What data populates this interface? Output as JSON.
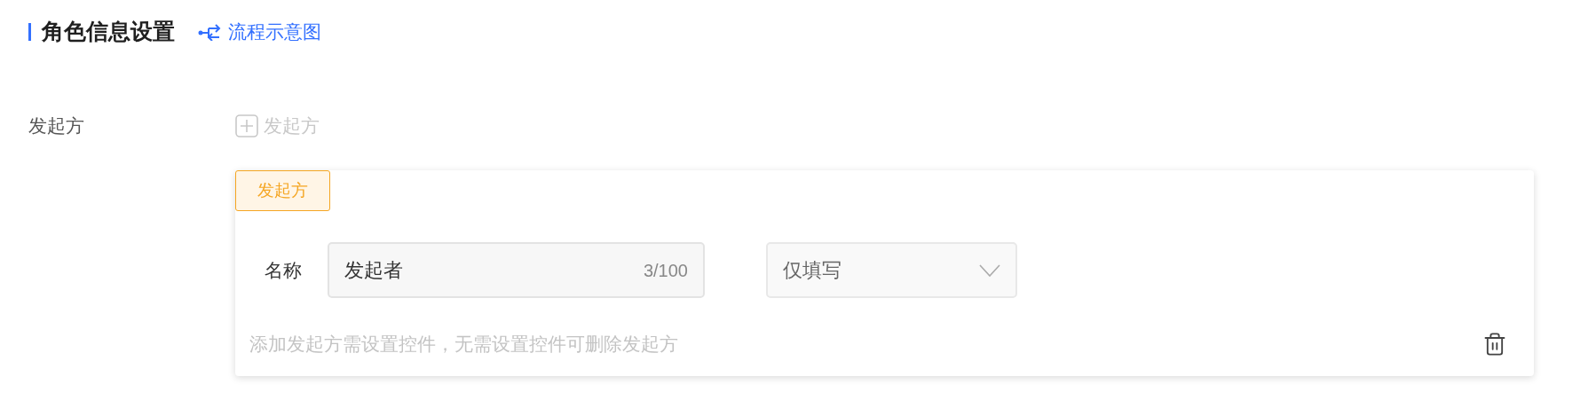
{
  "section": {
    "title": "角色信息设置",
    "link": "流程示意图"
  },
  "field": {
    "label": "发起方",
    "add_button": {
      "label": "发起方",
      "disabled": true
    }
  },
  "card": {
    "tag": "发起方",
    "name_label": "名称",
    "name_input": {
      "value": "发起者",
      "counter": "3/100"
    },
    "permission_select": {
      "value": "仅填写"
    },
    "hint": "添加发起方需设置控件，无需设置控件可删除发起方"
  }
}
